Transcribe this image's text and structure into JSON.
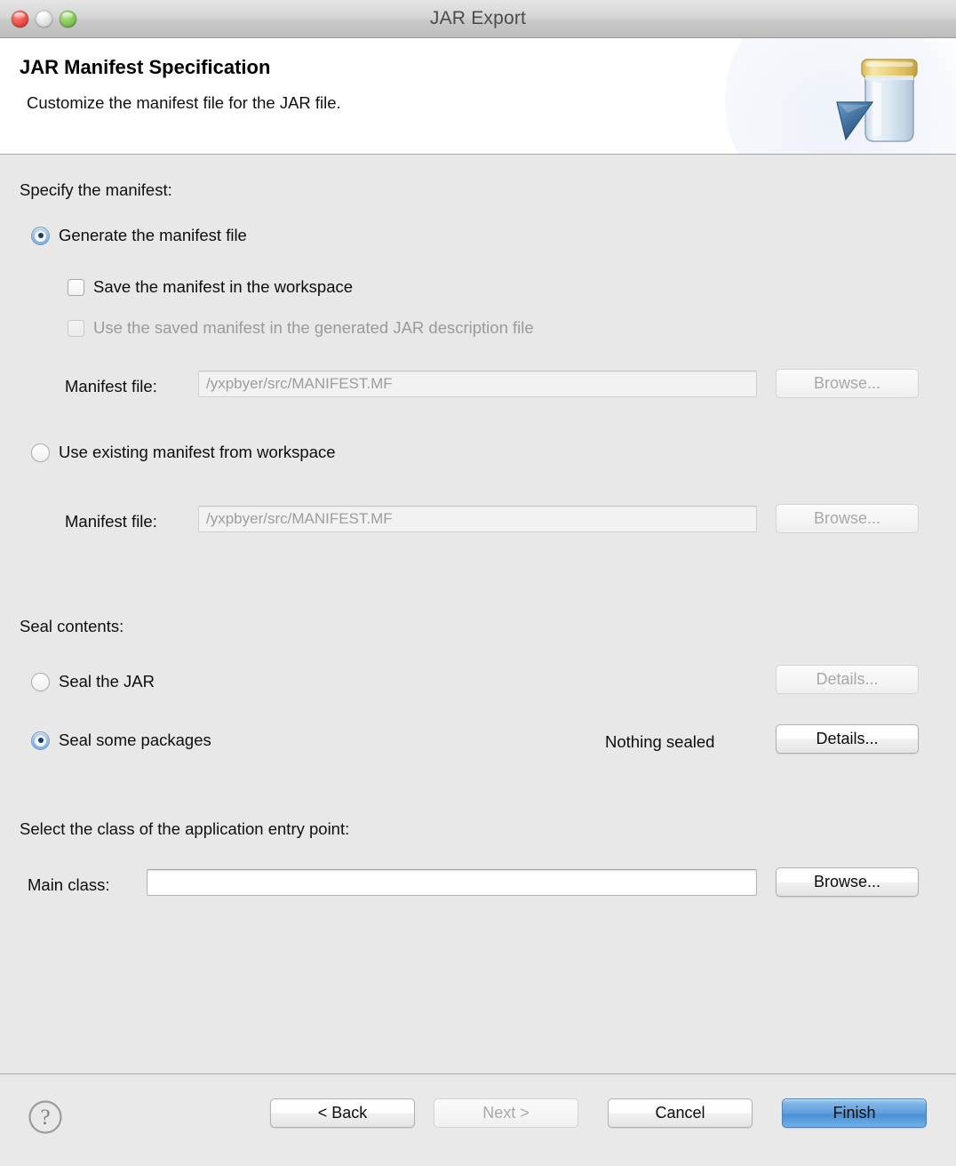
{
  "window": {
    "title": "JAR Export",
    "traffic_lights": [
      {
        "name": "close",
        "color": "#e8453c"
      },
      {
        "name": "minimize",
        "color": "#dddddd"
      },
      {
        "name": "zoom",
        "color": "#79c34a"
      }
    ]
  },
  "banner": {
    "title": "JAR Manifest Specification",
    "description": "Customize the manifest file for the JAR file.",
    "icon": "jar-export-icon"
  },
  "manifest_section": {
    "label": "Specify the manifest:",
    "generate_radio": {
      "label": "Generate the manifest file",
      "selected": true
    },
    "save_checkbox": {
      "label": "Save the manifest in the workspace",
      "checked": false,
      "disabled": false
    },
    "use_saved_checkbox": {
      "label": "Use the saved manifest in the generated JAR description file",
      "checked": false,
      "disabled": true
    },
    "generate_manifest_file": {
      "label": "Manifest file:",
      "value": "/yxpbyer/src/MANIFEST.MF",
      "disabled": true,
      "browse_label": "Browse...",
      "browse_disabled": true
    },
    "existing_radio": {
      "label": "Use existing manifest from workspace",
      "selected": false
    },
    "existing_manifest_file": {
      "label": "Manifest file:",
      "value": "/yxpbyer/src/MANIFEST.MF",
      "disabled": true,
      "browse_label": "Browse...",
      "browse_disabled": true
    }
  },
  "seal_section": {
    "label": "Seal contents:",
    "seal_jar_radio": {
      "label": "Seal the JAR",
      "selected": false,
      "details_label": "Details...",
      "details_disabled": true
    },
    "seal_packages_radio": {
      "label": "Seal some packages",
      "selected": true,
      "status": "Nothing sealed",
      "details_label": "Details...",
      "details_disabled": false
    }
  },
  "entry_point_section": {
    "label": "Select the class of the application entry point:",
    "main_class": {
      "label": "Main class:",
      "value": "",
      "placeholder": "",
      "browse_label": "Browse...",
      "browse_disabled": false
    }
  },
  "footer": {
    "help_icon": "help-question-icon",
    "back_label": "< Back",
    "next_label": "Next >",
    "next_disabled": true,
    "cancel_label": "Cancel",
    "finish_label": "Finish",
    "finish_is_default": true,
    "finish_accent": "#4a8fd4"
  }
}
